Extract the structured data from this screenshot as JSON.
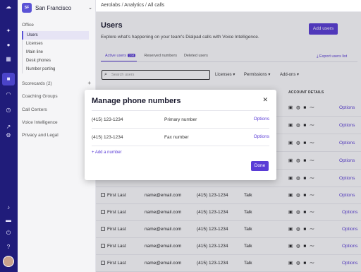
{
  "sidebar": {
    "office_badge": "SF",
    "office_name": "San Francisco",
    "section_office": "Office",
    "items": [
      {
        "label": "Users"
      },
      {
        "label": "Licenses"
      },
      {
        "label": "Main line"
      },
      {
        "label": "Desk phones"
      },
      {
        "label": "Number porting"
      }
    ],
    "scorecards": "Scorecards (2)",
    "coaching": "Coaching Groups",
    "call_centers": "Call Centers",
    "voice_intel": "Voice Intelligence",
    "privacy": "Privacy and Legal"
  },
  "breadcrumb": {
    "part1": "Aerolabs",
    "part2": "Analytics",
    "part3": "All calls"
  },
  "main": {
    "title": "Users",
    "subtitle": "Explore what's happening on your team's Dialpad calls with Voice Intelligence.",
    "add_users": "Add users",
    "tabs": [
      {
        "label": "Active users",
        "badge": "234"
      },
      {
        "label": "Reserved numbers"
      },
      {
        "label": "Deleted users"
      }
    ],
    "export": "Export users list",
    "search_placeholder": "Search users",
    "filters": [
      "Licenses",
      "Permissions",
      "Add-ons"
    ],
    "account_details": "ACCOUNT DETAILS",
    "rows": [
      {
        "name": "",
        "email": "",
        "phone": "",
        "type": "",
        "option": "Options"
      },
      {
        "name": "",
        "email": "",
        "phone": "",
        "type": "",
        "option": "Options"
      },
      {
        "name": "",
        "email": "",
        "phone": "",
        "type": "",
        "option": "Options"
      },
      {
        "name": "",
        "email": "",
        "phone": "",
        "type": "",
        "option": "Options"
      },
      {
        "name": "",
        "email": "",
        "phone": "",
        "type": "",
        "option": "Options"
      },
      {
        "name": "First Last",
        "email": "name@email.com",
        "phone": "(415) 123-1234",
        "type": "Talk",
        "option": "Options"
      },
      {
        "name": "First Last",
        "email": "name@email.com",
        "phone": "(415) 123-1234",
        "type": "Talk",
        "option": "Options"
      },
      {
        "name": "First Last",
        "email": "name@email.com",
        "phone": "(415) 123-1234",
        "type": "Talk",
        "option": "Options"
      },
      {
        "name": "First Last",
        "email": "name@email.com",
        "phone": "(415) 123-1234",
        "type": "Talk",
        "option": "Options"
      },
      {
        "name": "First Last",
        "email": "name@email.com",
        "phone": "(415) 123-1234",
        "type": "Talk",
        "option": "Options"
      }
    ]
  },
  "modal": {
    "title": "Manage phone numbers",
    "numbers": [
      {
        "number": "(415) 123-1234",
        "label": "Primary number",
        "option": "Options"
      },
      {
        "number": "(415) 123-1234",
        "label": "Fax number",
        "option": "Options"
      }
    ],
    "add_number": "+ Add a number",
    "done": "Done"
  },
  "colors": {
    "rail": "#201c7a",
    "accent": "#5a3cd6"
  }
}
